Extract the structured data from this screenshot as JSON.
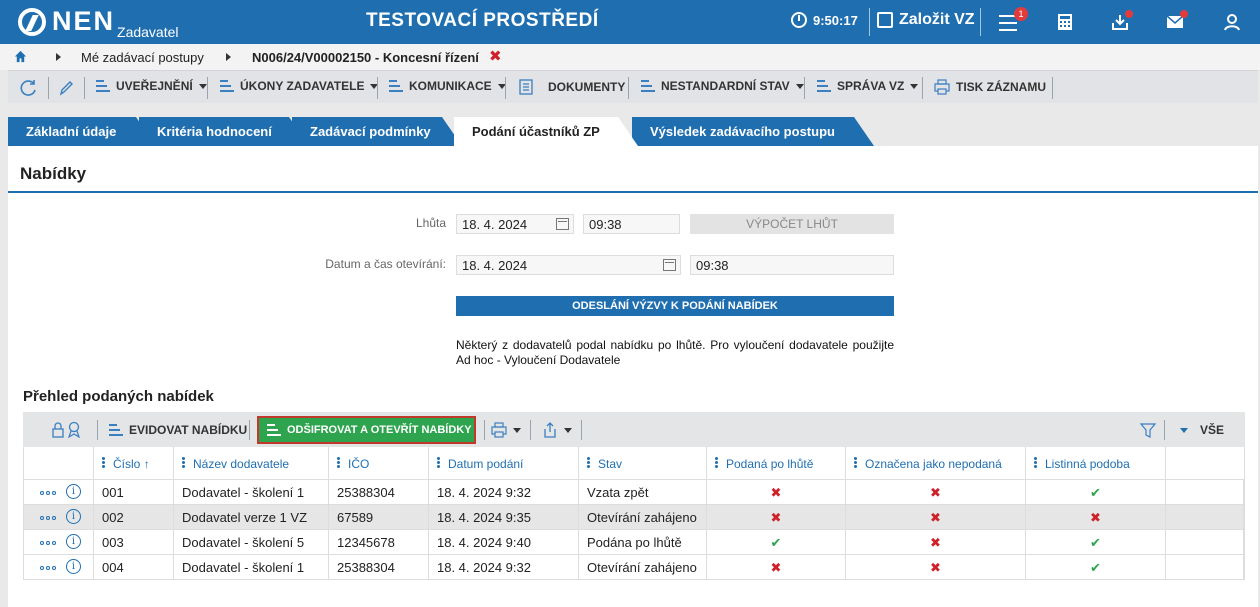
{
  "header": {
    "logo_text": "NEN",
    "logo_sub": "Zadavatel",
    "title": "TESTOVACÍ PROSTŘEDÍ",
    "time": "9:50:17",
    "create_vz": "Založit VZ",
    "notification_count": "1",
    "brand_color": "#1f6fb0"
  },
  "breadcrumb": {
    "items": [
      "Mé zadávací postupy",
      "N006/24/V00002150 - Koncesní řízení"
    ]
  },
  "toolbar": {
    "items": [
      "UVEŘEJNĚNÍ",
      "ÚKONY ZADAVATELE",
      "KOMUNIKACE",
      "DOKUMENTY",
      "NESTANDARDNÍ STAV",
      "SPRÁVA VZ",
      "TISK ZÁZNAMU"
    ]
  },
  "tabs": [
    "Základní údaje",
    "Kritéria hodnocení",
    "Zadávací podmínky",
    "Podání účastníků ZP",
    "Výsledek zadávacího postupu"
  ],
  "active_tab": "Podání účastníků ZP",
  "section": {
    "title": "Nabídky",
    "deadline_label": "Lhůta",
    "deadline_date": "18. 4. 2024",
    "deadline_time": "09:38",
    "calc_button": "VÝPOČET LHŮT",
    "open_label": "Datum a čas otevírání:",
    "open_date": "18. 4. 2024",
    "open_time": "09:38",
    "send_button": "ODESLÁNÍ VÝZVY K PODÁNÍ NABÍDEK",
    "notice": "Některý z dodavatelů podal nabídku po lhůtě. Pro vyloučení dodavatele použijte Ad hoc - Vyloučení Dodavatele"
  },
  "overview": {
    "title": "Přehled podaných nabídek",
    "register_button": "EVIDOVAT NABÍDKU",
    "decrypt_button": "ODŠIFROVAT A OTEVŘÍT NABÍDKY",
    "filter_all": "VŠE",
    "columns": [
      "Číslo",
      "Název dodavatele",
      "IČO",
      "Datum podání",
      "Stav",
      "Podaná po lhůtě",
      "Označena jako nepodaná",
      "Listinná podoba"
    ],
    "rows": [
      {
        "cislo": "001",
        "nazev": "Dodavatel - školení 1",
        "ico": "25388304",
        "datum": "18. 4. 2024 9:32",
        "stav": "Vzata zpět",
        "po_lhute": "x",
        "nepodana": "x",
        "listinna": "ok"
      },
      {
        "cislo": "002",
        "nazev": "Dodavatel verze 1 VZ",
        "ico": "67589",
        "datum": "18. 4. 2024 9:35",
        "stav": "Otevírání zahájeno",
        "po_lhute": "x",
        "nepodana": "x",
        "listinna": "x"
      },
      {
        "cislo": "003",
        "nazev": "Dodavatel - školení 5",
        "ico": "12345678",
        "datum": "18. 4. 2024 9:40",
        "stav": "Podána po lhůtě",
        "po_lhute": "ok",
        "nepodana": "x",
        "listinna": "ok"
      },
      {
        "cislo": "004",
        "nazev": "Dodavatel - školení 1",
        "ico": "25388304",
        "datum": "18. 4. 2024 9:32",
        "stav": "Otevírání zahájeno",
        "po_lhute": "x",
        "nepodana": "x",
        "listinna": "ok"
      }
    ]
  }
}
